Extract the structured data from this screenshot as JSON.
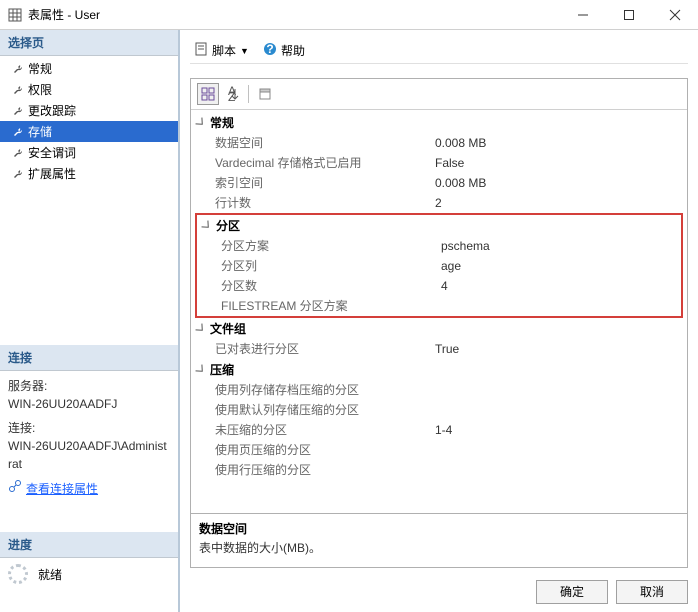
{
  "window": {
    "title": "表属性 - User"
  },
  "left": {
    "select_pages": "选择页",
    "nav": [
      {
        "label": "常规"
      },
      {
        "label": "权限"
      },
      {
        "label": "更改跟踪"
      },
      {
        "label": "存储"
      },
      {
        "label": "安全谓词"
      },
      {
        "label": "扩展属性"
      }
    ],
    "conn": {
      "heading": "连接",
      "server_label": "服务器:",
      "server_value": "WIN-26UU20AADFJ",
      "conn_label": "连接:",
      "conn_value": "WIN-26UU20AADFJ\\Administrat",
      "view_link": "查看连接属性"
    },
    "progress": {
      "heading": "进度",
      "status": "就绪"
    }
  },
  "right": {
    "toolbar": {
      "script": "脚本",
      "help": "帮助"
    },
    "grid": {
      "cats": [
        {
          "name": "常规",
          "rows": [
            {
              "k": "数据空间",
              "v": "0.008 MB"
            },
            {
              "k": "Vardecimal 存储格式已启用",
              "v": "False"
            },
            {
              "k": "索引空间",
              "v": "0.008 MB"
            },
            {
              "k": "行计数",
              "v": "2"
            }
          ]
        },
        {
          "name": "分区",
          "highlight": true,
          "rows": [
            {
              "k": "分区方案",
              "v": "pschema"
            },
            {
              "k": "分区列",
              "v": "age"
            },
            {
              "k": "分区数",
              "v": "4"
            },
            {
              "k": "FILESTREAM 分区方案",
              "v": ""
            }
          ]
        },
        {
          "name": "文件组",
          "rows": [
            {
              "k": "已对表进行分区",
              "v": "True"
            }
          ]
        },
        {
          "name": "压缩",
          "rows": [
            {
              "k": "使用列存储存档压缩的分区",
              "v": ""
            },
            {
              "k": "使用默认列存储压缩的分区",
              "v": ""
            },
            {
              "k": "未压缩的分区",
              "v": "1-4"
            },
            {
              "k": "使用页压缩的分区",
              "v": ""
            },
            {
              "k": "使用行压缩的分区",
              "v": ""
            }
          ]
        }
      ],
      "desc": {
        "title": "数据空间",
        "text": "表中数据的大小(MB)。"
      }
    },
    "buttons": {
      "ok": "确定",
      "cancel": "取消"
    }
  }
}
